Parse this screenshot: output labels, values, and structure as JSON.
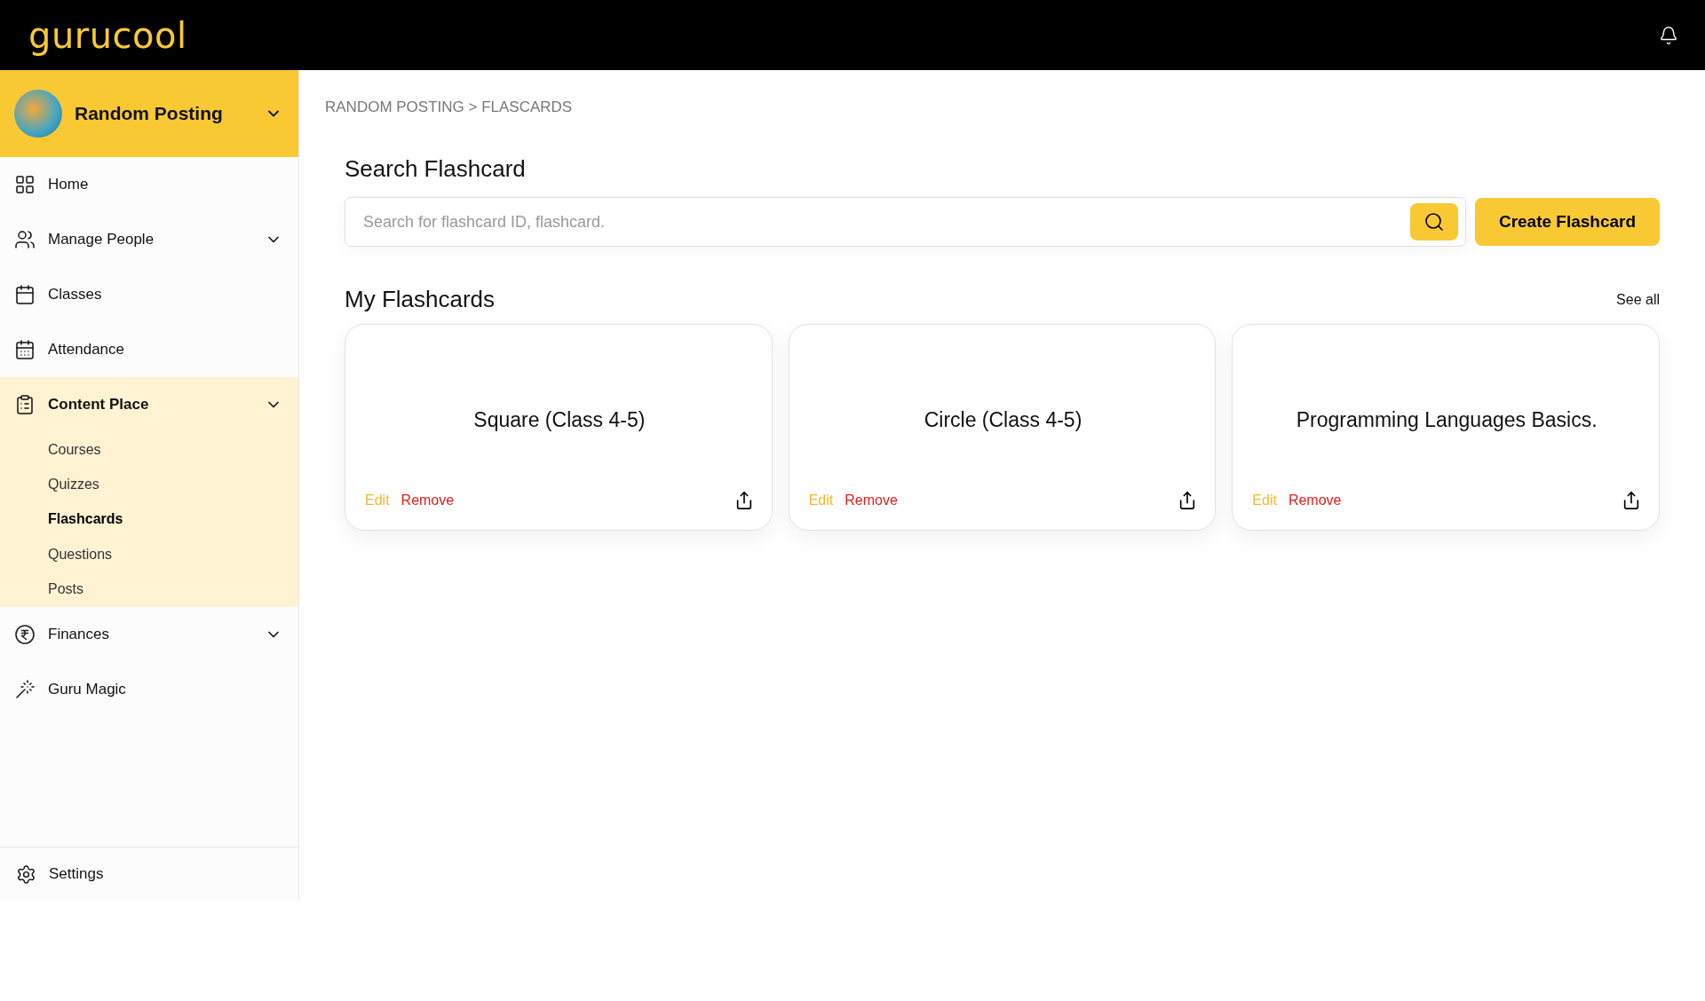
{
  "header": {
    "logo": "gurucool"
  },
  "workspace": {
    "name": "Random Posting"
  },
  "sidebar": {
    "items": [
      {
        "label": "Home",
        "has_menu": false,
        "expanded": false
      },
      {
        "label": "Manage People",
        "has_menu": true,
        "expanded": false
      },
      {
        "label": "Classes",
        "has_menu": false,
        "expanded": false
      },
      {
        "label": "Attendance",
        "has_menu": false,
        "expanded": false
      },
      {
        "label": "Content Place",
        "has_menu": true,
        "expanded": true,
        "children": [
          {
            "label": "Courses",
            "selected": false
          },
          {
            "label": "Quizzes",
            "selected": false
          },
          {
            "label": "Flashcards",
            "selected": true
          },
          {
            "label": "Questions",
            "selected": false
          },
          {
            "label": "Posts",
            "selected": false
          }
        ]
      },
      {
        "label": "Finances",
        "has_menu": true,
        "expanded": false
      },
      {
        "label": "Guru Magic",
        "has_menu": false,
        "expanded": false
      }
    ],
    "footer": {
      "label": "Settings"
    }
  },
  "breadcrumb": "RANDOM POSTING > FLASCARDS",
  "search": {
    "title": "Search Flashcard",
    "placeholder": "Search for flashcard ID, flashcard.",
    "button": "Create Flashcard"
  },
  "flashcards": {
    "title": "My Flashcards",
    "see_all": "See all",
    "cards": [
      {
        "title": "Square (Class 4-5)",
        "edit": "Edit",
        "remove": "Remove"
      },
      {
        "title": "Circle (Class 4-5)",
        "edit": "Edit",
        "remove": "Remove"
      },
      {
        "title": "Programming Languages Basics.",
        "edit": "Edit",
        "remove": "Remove"
      }
    ]
  }
}
